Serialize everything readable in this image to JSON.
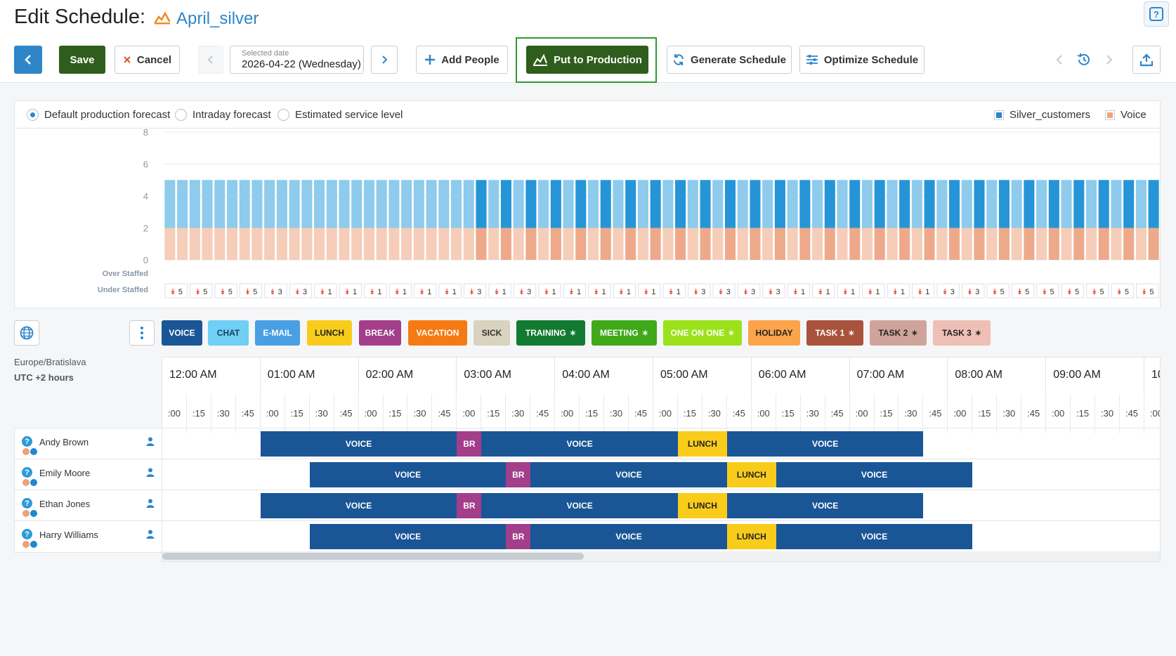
{
  "page": {
    "title": "Edit Schedule:",
    "schedule_name": "April_silver"
  },
  "toolbar": {
    "save_label": "Save",
    "cancel_label": "Cancel",
    "selected_date_label": "Selected date",
    "selected_date_value": "2026-04-22 (Wednesday)",
    "add_people_label": "Add People",
    "put_to_production_label": "Put to Production",
    "generate_schedule_label": "Generate Schedule",
    "optimize_schedule_label": "Optimize Schedule"
  },
  "forecast": {
    "options": [
      "Default production forecast",
      "Intraday forecast",
      "Estimated service level"
    ],
    "selected_option": "Default production forecast",
    "legend": [
      {
        "label": "Silver_customers",
        "color": "#2a87c9"
      },
      {
        "label": "Voice",
        "color": "#f0a47c"
      }
    ],
    "over_staffed_label": "Over Staffed",
    "under_staffed_label": "Under Staffed"
  },
  "chart_data": {
    "type": "bar",
    "y_ticks": [
      0,
      2,
      4,
      6,
      8
    ],
    "ylim": [
      0,
      8
    ],
    "gridlines": true,
    "series": [
      {
        "name": "Silver_customers",
        "values": [
          5,
          5,
          5,
          5,
          5,
          5,
          5,
          5,
          5,
          5,
          5,
          5,
          5,
          5,
          5,
          5,
          5,
          5,
          5,
          5,
          5,
          5,
          5,
          5,
          5,
          5,
          5,
          5,
          5,
          5,
          5,
          5,
          5,
          5,
          5,
          5,
          5,
          5,
          5,
          5,
          5,
          5,
          5,
          5,
          5,
          5,
          5,
          5,
          5,
          5,
          5,
          5,
          5,
          5,
          5,
          5,
          5,
          5,
          5,
          5,
          5,
          5,
          5,
          5,
          5,
          5,
          5,
          5,
          5,
          5,
          5,
          5,
          5,
          5,
          5,
          5,
          5,
          5,
          5,
          5
        ]
      },
      {
        "name": "Voice",
        "values": [
          0,
          0,
          0,
          0,
          0,
          0,
          0,
          0,
          0,
          0,
          0,
          0,
          0,
          0,
          0,
          0,
          0,
          0,
          0,
          0,
          0,
          0,
          0,
          0,
          2,
          2,
          2,
          2,
          4,
          4,
          4,
          4,
          4,
          4,
          4,
          4,
          4,
          4,
          4,
          4,
          4,
          4,
          4,
          4,
          4,
          4,
          4,
          4,
          4,
          4,
          4,
          4,
          4,
          4,
          4,
          4,
          4,
          4,
          4,
          4,
          4,
          4,
          4,
          4,
          4,
          4,
          4,
          4,
          4,
          4,
          4,
          4,
          4,
          4,
          4,
          4,
          4,
          4,
          4,
          4
        ]
      }
    ],
    "under_staffed": [
      "5",
      "5",
      "5",
      "5",
      "3",
      "3",
      "1",
      "1",
      "1",
      "1",
      "1",
      "1",
      "3",
      "1",
      "3",
      "1",
      "1",
      "1",
      "1",
      "1",
      "1",
      "3",
      "3",
      "3",
      "3",
      "1",
      "1",
      "1",
      "1",
      "1",
      "1",
      "3",
      "3",
      "5",
      "5",
      "5",
      "5",
      "5",
      "5",
      "5"
    ]
  },
  "activities": [
    {
      "label": "VOICE",
      "bg": "#1a5696",
      "fg": "#ffffff",
      "pin": false
    },
    {
      "label": "CHAT",
      "bg": "#6fcff4",
      "fg": "#1b3d5c",
      "pin": false
    },
    {
      "label": "E-MAIL",
      "bg": "#4a9fe3",
      "fg": "#ffffff",
      "pin": false
    },
    {
      "label": "LUNCH",
      "bg": "#f9cc1b",
      "fg": "#222222",
      "pin": false
    },
    {
      "label": "BREAK",
      "bg": "#a23e8a",
      "fg": "#ffffff",
      "pin": false
    },
    {
      "label": "VACATION",
      "bg": "#f57a14",
      "fg": "#ffffff",
      "pin": false
    },
    {
      "label": "SICK",
      "bg": "#d9d2bf",
      "fg": "#333333",
      "pin": false
    },
    {
      "label": "TRAINING",
      "bg": "#137a31",
      "fg": "#ffffff",
      "pin": true
    },
    {
      "label": "MEETING",
      "bg": "#3fa91a",
      "fg": "#ffffff",
      "pin": true
    },
    {
      "label": "ONE ON ONE",
      "bg": "#9be21a",
      "fg": "#ffffff",
      "pin": true
    },
    {
      "label": "HOLIDAY",
      "bg": "#fba44a",
      "fg": "#222222",
      "pin": false
    },
    {
      "label": "TASK 1",
      "bg": "#a9523c",
      "fg": "#ffffff",
      "pin": true
    },
    {
      "label": "TASK 2",
      "bg": "#cfa39a",
      "fg": "#222222",
      "pin": true
    },
    {
      "label": "TASK 3",
      "bg": "#eebfb5",
      "fg": "#222222",
      "pin": true
    }
  ],
  "timeline": {
    "timezone": "Europe/Bratislava",
    "utc_offset": "UTC +2 hours",
    "hours": [
      "12:00 AM",
      "01:00 AM",
      "02:00 AM",
      "03:00 AM",
      "04:00 AM",
      "05:00 AM",
      "06:00 AM",
      "07:00 AM",
      "08:00 AM",
      "09:00 AM",
      "10:00 AM"
    ],
    "minute_marks": [
      ":00",
      ":15",
      ":30",
      ":45"
    ]
  },
  "people": [
    {
      "name": "Andy Brown",
      "blocks": [
        {
          "label": "VOICE",
          "start": "01:00",
          "end": "03:00",
          "bg": "#1a5696",
          "fg": "#ffffff"
        },
        {
          "label": "BR",
          "start": "03:00",
          "end": "03:15",
          "bg": "#a23e8a",
          "fg": "#ffffff"
        },
        {
          "label": "VOICE",
          "start": "03:15",
          "end": "05:15",
          "bg": "#1a5696",
          "fg": "#ffffff"
        },
        {
          "label": "LUNCH",
          "start": "05:15",
          "end": "05:45",
          "bg": "#f9cc1b",
          "fg": "#222222"
        },
        {
          "label": "VOICE",
          "start": "05:45",
          "end": "07:45",
          "bg": "#1a5696",
          "fg": "#ffffff"
        }
      ]
    },
    {
      "name": "Emily Moore",
      "blocks": [
        {
          "label": "VOICE",
          "start": "01:30",
          "end": "03:30",
          "bg": "#1a5696",
          "fg": "#ffffff"
        },
        {
          "label": "BR",
          "start": "03:30",
          "end": "03:45",
          "bg": "#a23e8a",
          "fg": "#ffffff"
        },
        {
          "label": "VOICE",
          "start": "03:45",
          "end": "05:45",
          "bg": "#1a5696",
          "fg": "#ffffff"
        },
        {
          "label": "LUNCH",
          "start": "05:45",
          "end": "06:15",
          "bg": "#f9cc1b",
          "fg": "#222222"
        },
        {
          "label": "VOICE",
          "start": "06:15",
          "end": "08:15",
          "bg": "#1a5696",
          "fg": "#ffffff"
        }
      ]
    },
    {
      "name": "Ethan Jones",
      "blocks": [
        {
          "label": "VOICE",
          "start": "01:00",
          "end": "03:00",
          "bg": "#1a5696",
          "fg": "#ffffff"
        },
        {
          "label": "BR",
          "start": "03:00",
          "end": "03:15",
          "bg": "#a23e8a",
          "fg": "#ffffff"
        },
        {
          "label": "VOICE",
          "start": "03:15",
          "end": "05:15",
          "bg": "#1a5696",
          "fg": "#ffffff"
        },
        {
          "label": "LUNCH",
          "start": "05:15",
          "end": "05:45",
          "bg": "#f9cc1b",
          "fg": "#222222"
        },
        {
          "label": "VOICE",
          "start": "05:45",
          "end": "07:45",
          "bg": "#1a5696",
          "fg": "#ffffff"
        }
      ]
    },
    {
      "name": "Harry Williams",
      "blocks": [
        {
          "label": "VOICE",
          "start": "01:30",
          "end": "03:30",
          "bg": "#1a5696",
          "fg": "#ffffff"
        },
        {
          "label": "BR",
          "start": "03:30",
          "end": "03:45",
          "bg": "#a23e8a",
          "fg": "#ffffff"
        },
        {
          "label": "VOICE",
          "start": "03:45",
          "end": "05:45",
          "bg": "#1a5696",
          "fg": "#ffffff"
        },
        {
          "label": "LUNCH",
          "start": "05:45",
          "end": "06:15",
          "bg": "#f9cc1b",
          "fg": "#222222"
        },
        {
          "label": "VOICE",
          "start": "06:15",
          "end": "08:15",
          "bg": "#1a5696",
          "fg": "#ffffff"
        }
      ]
    }
  ]
}
